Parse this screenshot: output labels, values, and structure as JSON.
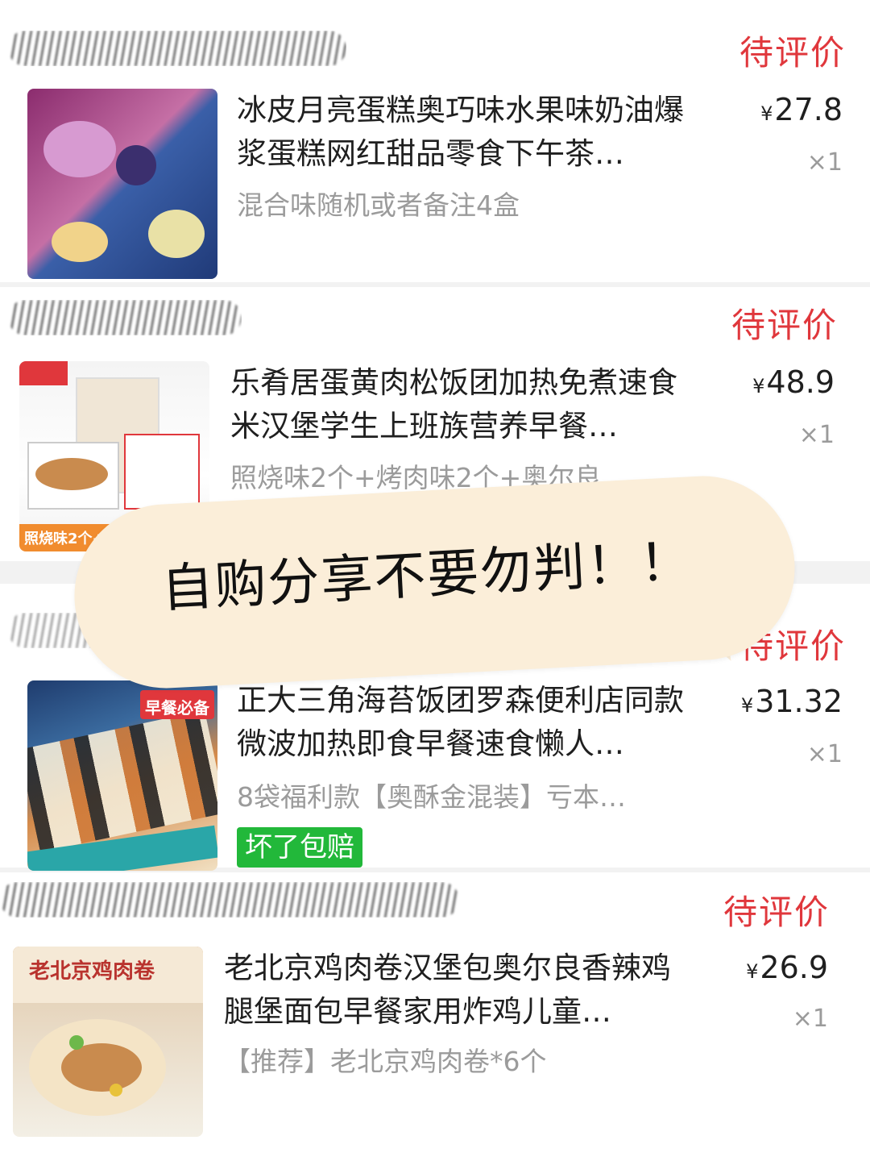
{
  "orders": [
    {
      "status": "待评价",
      "title": "冰皮月亮蛋糕奥巧味水果味奶油爆浆蛋糕网红甜品零食下午茶…",
      "spec": "混合味随机或者备注4盒",
      "price": "27.8",
      "currency": "¥",
      "qty": "×1",
      "thumbnail_icon": "mooncake-product-image"
    },
    {
      "status": "待评价",
      "title": "乐肴居蛋黄肉松饭团加热免煮速食米汉堡学生上班族营养早餐…",
      "spec": "照烧味2个+烤肉味2个+奥尔良…",
      "price": "48.9",
      "currency": "¥",
      "qty": "×1",
      "thumbnail_icon": "rice-burger-product-image",
      "thumbnail_caption": "照烧味2个+烤肉"
    },
    {
      "status": "待评价",
      "title": "正大三角海苔饭团罗森便利店同款微波加热即食早餐速食懒人…",
      "spec": "8袋福利款【奥酥金混装】亏本…",
      "price": "31.32",
      "currency": "¥",
      "qty": "×1",
      "tag": "坏了包赔",
      "thumbnail_icon": "rice-ball-product-image",
      "thumbnail_caption": "早餐必备"
    },
    {
      "status": "待评价",
      "title": "老北京鸡肉卷汉堡包奥尔良香辣鸡腿堡面包早餐家用炸鸡儿童…",
      "spec": "【推荐】老北京鸡肉卷*6个",
      "price": "26.9",
      "currency": "¥",
      "qty": "×1",
      "thumbnail_icon": "chicken-wrap-product-image",
      "thumbnail_caption": "老北京鸡肉卷"
    }
  ],
  "overlay": {
    "text": "自购分享不要勿判！！"
  },
  "colors": {
    "status": "#e0373c",
    "tag": "#22b83a",
    "overlay_bg": "#fbeed9"
  }
}
